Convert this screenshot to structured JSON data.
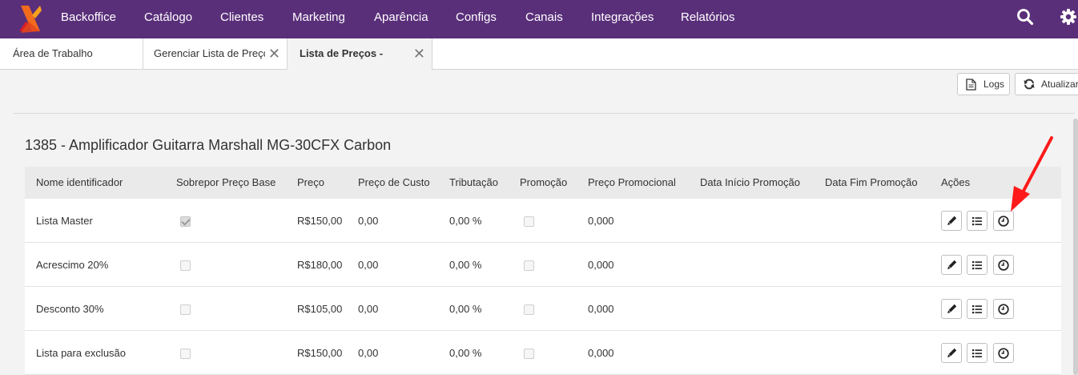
{
  "nav": {
    "items": [
      "Backoffice",
      "Catálogo",
      "Clientes",
      "Marketing",
      "Aparência",
      "Configs",
      "Canais",
      "Integrações",
      "Relatórios"
    ],
    "icons": [
      "search-icon",
      "gear-icon"
    ],
    "bg_color": "#5a2f7a"
  },
  "tabs": [
    {
      "label": "Área de Trabalho",
      "closable": false
    },
    {
      "label": "Gerenciar Lista de Preços",
      "closable": true
    },
    {
      "label": "Lista de Preços -",
      "closable": true,
      "active": true
    }
  ],
  "toolbar": {
    "logs_label": "Logs",
    "refresh_label": "Atualizar"
  },
  "product_title": "1385 - Amplificador Guitarra Marshall MG-30CFX Carbon",
  "grid": {
    "columns": [
      "Nome identificador",
      "Sobrepor Preço Base",
      "Preço",
      "Preço de Custo",
      "Tributação",
      "Promoção",
      "Preço Promocional",
      "Data Início Promoção",
      "Data Fim Promoção",
      "Ações"
    ],
    "rows": [
      {
        "name": "Lista Master",
        "override": true,
        "price": "R$150,00",
        "cost": "0,00",
        "tax": "0,00 %",
        "promo": false,
        "promo_price": "0,000",
        "start": "",
        "end": ""
      },
      {
        "name": "Acrescimo 20%",
        "override": false,
        "price": "R$180,00",
        "cost": "0,00",
        "tax": "0,00 %",
        "promo": false,
        "promo_price": "0,000",
        "start": "",
        "end": ""
      },
      {
        "name": "Desconto 30%",
        "override": false,
        "price": "R$105,00",
        "cost": "0,00",
        "tax": "0,00 %",
        "promo": false,
        "promo_price": "0,000",
        "start": "",
        "end": ""
      },
      {
        "name": "Lista para exclusão",
        "override": false,
        "price": "R$150,00",
        "cost": "0,00",
        "tax": "0,00 %",
        "promo": false,
        "promo_price": "0,000",
        "start": "",
        "end": ""
      }
    ],
    "action_icons": [
      "pencil-icon",
      "list-icon",
      "clock-icon"
    ]
  },
  "annotation": {
    "arrow_color": "#ff1a1a"
  }
}
